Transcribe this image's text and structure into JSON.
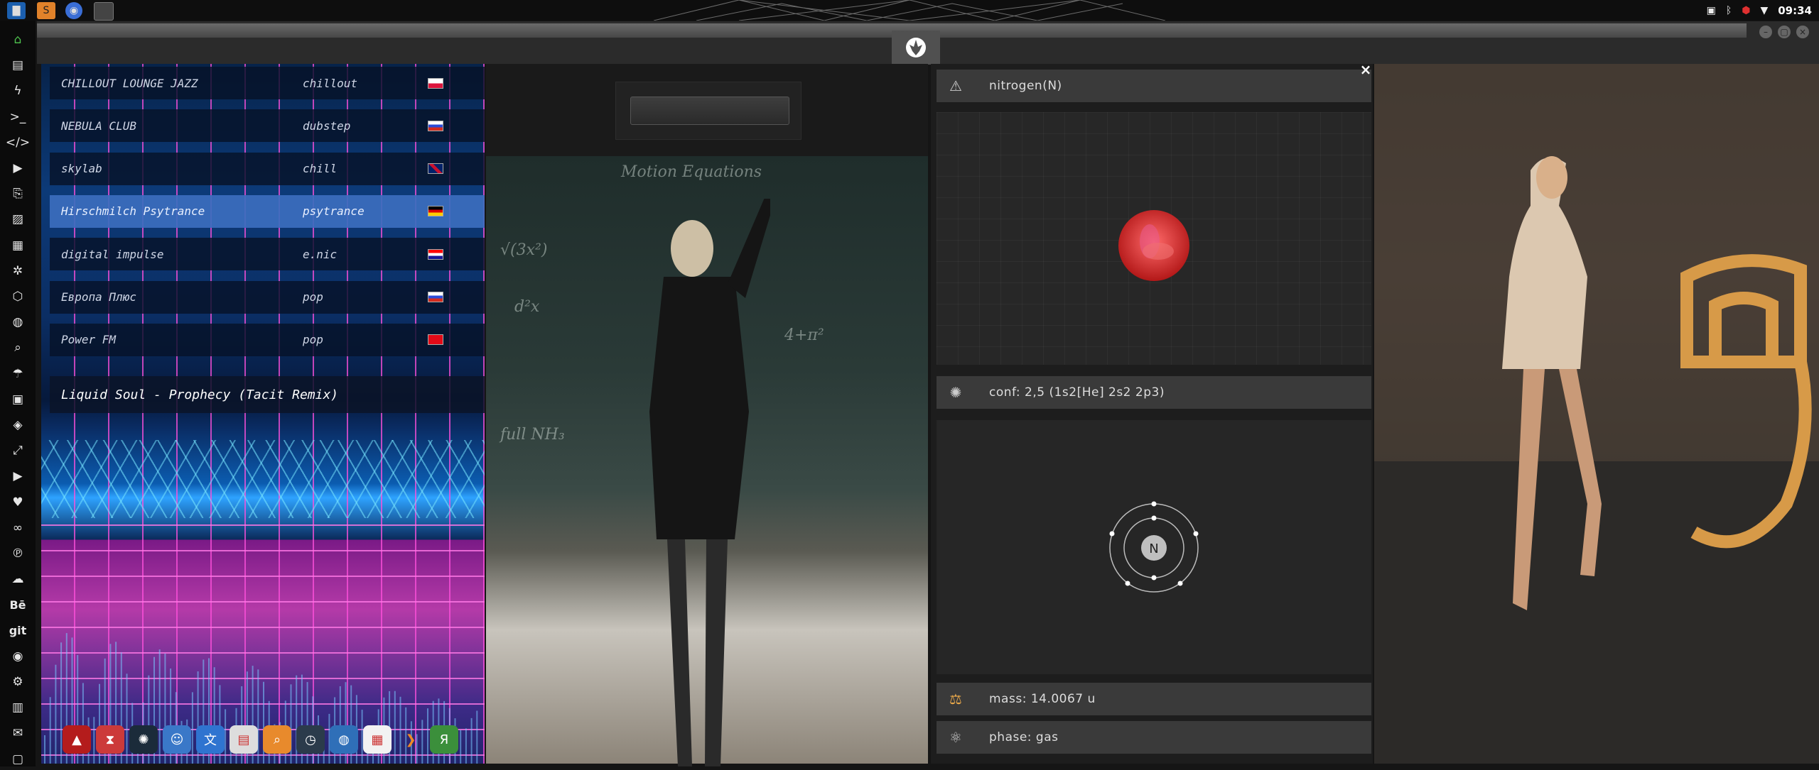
{
  "topbar": {
    "clock": "09:34",
    "apps": [
      "files-icon",
      "sublime-icon",
      "chromium-icon",
      "terminal-icon"
    ]
  },
  "sidebar": {
    "items": [
      {
        "icon": "home-icon"
      },
      {
        "icon": "document-icon"
      },
      {
        "icon": "bolt-icon"
      },
      {
        "icon": "terminal-icon"
      },
      {
        "icon": "code-icon"
      },
      {
        "icon": "play-icon"
      },
      {
        "icon": "copy-icon"
      },
      {
        "icon": "image-icon"
      },
      {
        "icon": "news-icon"
      },
      {
        "icon": "settings-icon"
      },
      {
        "icon": "hexagon-icon"
      },
      {
        "icon": "globe-icon"
      },
      {
        "icon": "search-icon"
      },
      {
        "icon": "umbrella-icon"
      },
      {
        "icon": "contact-icon"
      },
      {
        "icon": "tag-icon"
      },
      {
        "icon": "expand-icon"
      },
      {
        "icon": "youtube-icon"
      },
      {
        "icon": "heart-icon"
      },
      {
        "icon": "lastfm-icon"
      },
      {
        "icon": "pinterest-icon"
      },
      {
        "icon": "cloud-icon"
      },
      {
        "icon": "behance-icon",
        "label": "Bē"
      },
      {
        "icon": "git-icon",
        "label": "git"
      },
      {
        "icon": "github-icon"
      },
      {
        "icon": "bike-icon"
      },
      {
        "icon": "map-icon"
      },
      {
        "icon": "mail-icon"
      },
      {
        "icon": "chat-icon"
      }
    ]
  },
  "radio": {
    "stations": [
      {
        "name": "CHILLOUT LOUNGE JAZZ",
        "genre": "chillout",
        "flag": "pl"
      },
      {
        "name": "NEBULA CLUB",
        "genre": "dubstep",
        "flag": "ru"
      },
      {
        "name": "skylab",
        "genre": "chill",
        "flag": "gb"
      },
      {
        "name": "Hirschmilch Psytrance",
        "genre": "psytrance",
        "flag": "de",
        "active": true
      },
      {
        "name": "digital impulse",
        "genre": "e.nic",
        "flag": "hr"
      },
      {
        "name": "Европа Плюс",
        "genre": "pop",
        "flag": "ru"
      },
      {
        "name": "Power FM",
        "genre": "pop",
        "flag": "tr"
      }
    ],
    "now_playing": "Liquid Soul - Prophecy (Tacit Remix)"
  },
  "dock": {
    "items": [
      "arch-icon",
      "hourglass-icon",
      "atom-app-icon",
      "finder-icon",
      "translate-icon",
      "calendar-app-icon",
      "search-app-icon",
      "clock-icon",
      "browser-icon",
      "calendar-icon",
      "forward-icon",
      "yandex-icon"
    ]
  },
  "element": {
    "name_line": "nitrogen(N)",
    "conf_line": "conf: 2,5 (1s2[He] 2s2 2p3)",
    "symbol": "N",
    "mass_line": "mass: 14.0067 u",
    "phase_line": "phase: gas",
    "close_label": "×"
  },
  "colors": {
    "station_active": "#3c6ebe",
    "element_row": "#3a3a3a",
    "orbital": "#d63a3a"
  }
}
